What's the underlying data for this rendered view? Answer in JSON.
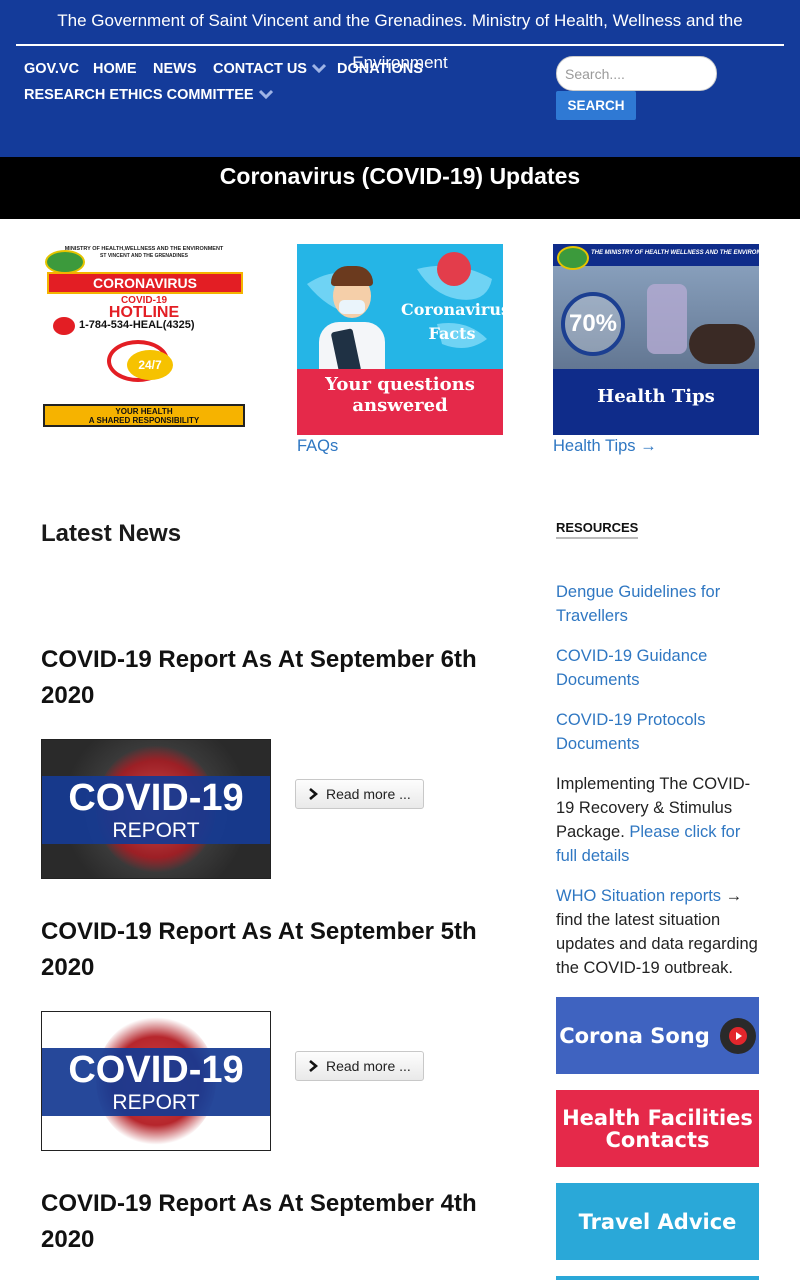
{
  "header": {
    "gov_title": "The Government of Saint Vincent and the Grenadines. Ministry of Health, Wellness and the Environment",
    "nav": {
      "govvc": "GOV.VC",
      "home": "HOME",
      "news": "NEWS",
      "contact": "CONTACT US",
      "donations": "DONATIONS",
      "research": "RESEARCH ETHICS COMMITTEE"
    },
    "search": {
      "placeholder": "Search....",
      "button": "SEARCH"
    }
  },
  "banner": {
    "title": "Coronavirus (COVID-19) Updates"
  },
  "tiles": {
    "hotline": {
      "ministry": "MINISTRY OF HEALTH,WELLNESS AND THE ENVIRONMENT",
      "country": "ST VINCENT AND THE GRENADINES",
      "heading": "CORONAVIRUS",
      "sub": "COVID-19",
      "hotline": "HOTLINE",
      "number": "1-784-534-HEAL(4325)",
      "hours": "24/7",
      "footer_1": "YOUR HEALTH",
      "footer_2": "A SHARED RESPONSIBILITY"
    },
    "facts": {
      "line1": "Coronavirus",
      "line2": "Facts",
      "bottom1": "Your questions",
      "bottom2": "answered",
      "link": "FAQs"
    },
    "tips": {
      "ministry": "THE MINISTRY OF HEALTH WELLNESS AND THE ENVIRONMENT",
      "percent": "70%",
      "bottom": "Health Tips",
      "link": "Health Tips →"
    }
  },
  "news": {
    "title": "Latest News",
    "readmore": "Read more ...",
    "thumb_line1": "COVID-19",
    "thumb_line2": "REPORT",
    "articles": [
      {
        "title": "COVID-19 Report As At September 6th 2020"
      },
      {
        "title": "COVID-19 Report As At September 5th 2020"
      },
      {
        "title": "COVID-19 Report As At September 4th 2020"
      }
    ]
  },
  "resources": {
    "title": "RESOURCES",
    "dengue": "Dengue Guidelines for Travellers",
    "guidance": "COVID-19 Guidance Documents",
    "protocols": "COVID-19 Protocols Documents",
    "stimulus_text": "Implementing The COVID-19 Recovery & Stimulus Package.",
    "stimulus_link": "Please click for full details",
    "who_link": "WHO Situation reports",
    "who_text": " → find the latest situation updates and data regarding the COVID-19 outbreak.",
    "btn_song": "Corona Song",
    "btn_facilities_1": "Health Facilities",
    "btn_facilities_2": "Contacts",
    "btn_travel": "Travel Advice"
  },
  "colors": {
    "header_bg": "#143b9a",
    "link": "#2f77c2",
    "search_btn": "#2f79d4",
    "song_bg": "#3f63c0",
    "facilities_bg": "#e5294a",
    "travel_bg": "#2aa8d8"
  }
}
